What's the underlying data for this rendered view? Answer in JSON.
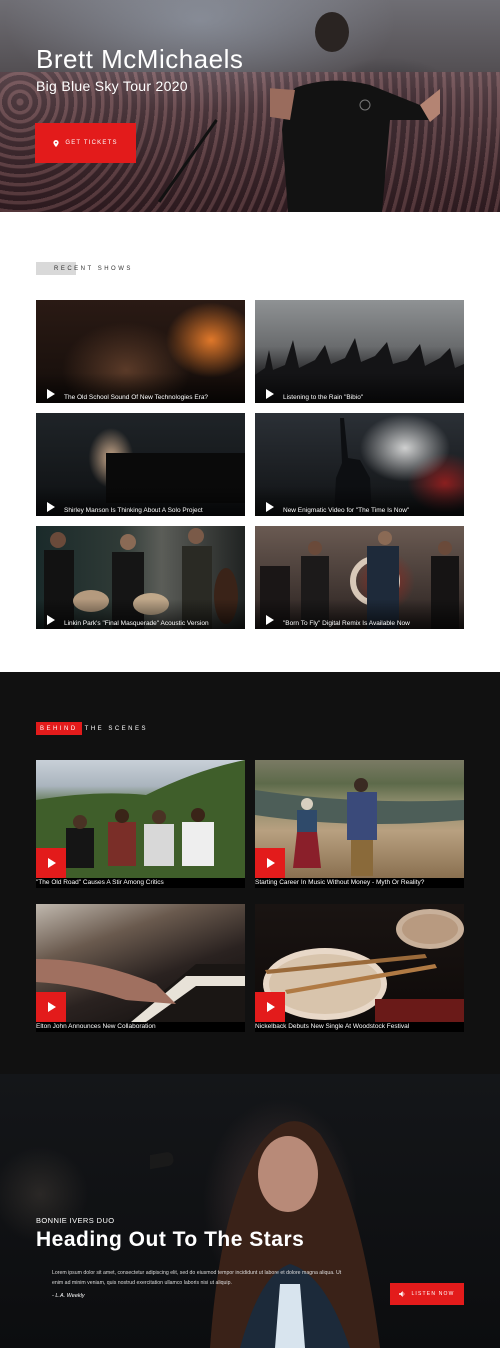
{
  "hero": {
    "title": "Brett McMichaels",
    "subtitle": "Big Blue Sky Tour 2020",
    "button_label": "Get Tickets",
    "button_icon": "location-pin-icon"
  },
  "recent_shows": {
    "tag": "Recent Shows",
    "items": [
      {
        "caption": "The Old School Sound Of New Technologies Era?"
      },
      {
        "caption": "Listening to the Rain \"Bibio\""
      },
      {
        "caption": "Shirley Manson Is Thinking About A Solo Project"
      },
      {
        "caption": "New Enigmatic Video for \"The Time Is Now\""
      },
      {
        "caption": "Linkin Park's \"Final Masquerade\" Acoustic Version"
      },
      {
        "caption": "\"Born To Fly\" Digital Remix Is Available Now"
      }
    ]
  },
  "behind_the_scenes": {
    "tag_highlight": "Behind",
    "tag_rest": "The Scenes",
    "items": [
      {
        "caption": "\"The Old Road\" Causes A Stir Among Critics"
      },
      {
        "caption": "Starting Career In Music Without Money - Myth Or Reality?"
      },
      {
        "caption": "Elton John Announces New Collaboration"
      },
      {
        "caption": "Nickelback Debuts New Single At Woodstock Festival"
      }
    ]
  },
  "feature": {
    "kicker": "Bonnie Ivers Duo",
    "heading": "Heading Out To The Stars",
    "body": "Lorem ipsum dolor sit amet, consectetur adipiscing elit, sed do eiusmod tempor incididunt ut labore et dolore magna aliqua. Ut enim ad minim veniam, quis nostrud exercitation ullamco laboris nisi ut aliquip.",
    "quote": "- L.A. Weekly",
    "button_label": "Listen Now",
    "button_icon": "speaker-icon"
  },
  "colors": {
    "accent": "#e31b1b",
    "dark_section": "#111111"
  }
}
